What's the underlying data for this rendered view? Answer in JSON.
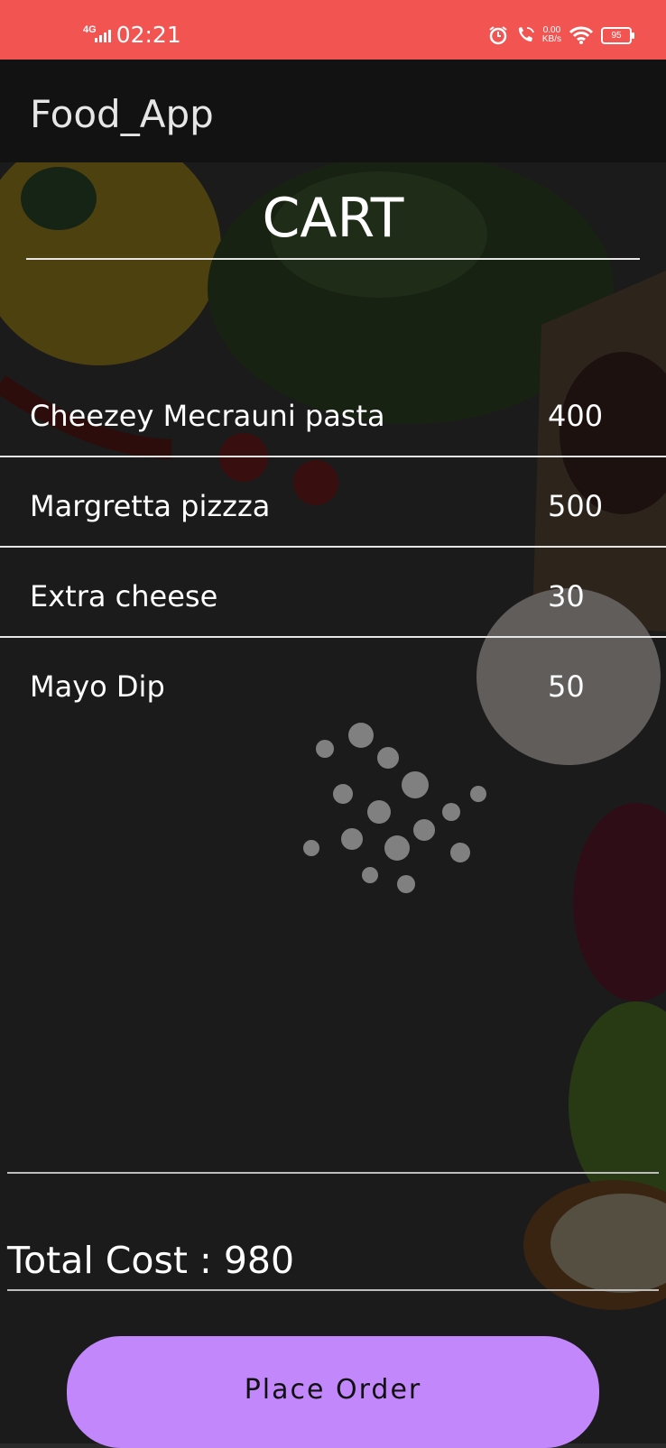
{
  "status_bar": {
    "network": "4G",
    "time": "02:21",
    "speed": "0.00",
    "speed_unit": "KB/s",
    "battery": "95",
    "icons": [
      "signal-icon",
      "alarm-icon",
      "wifi-call-icon",
      "wifi-icon",
      "battery-icon"
    ]
  },
  "app": {
    "title": "Food_App"
  },
  "cart": {
    "title": "CART",
    "items": [
      {
        "name": "Cheezey Mecrauni pasta",
        "price": "400"
      },
      {
        "name": "Margretta pizzza",
        "price": "500"
      },
      {
        "name": "Extra cheese",
        "price": "30"
      },
      {
        "name": "Mayo Dip",
        "price": "50"
      }
    ],
    "total_label": "Total Cost : 980",
    "button_label": "Place Order"
  },
  "colors": {
    "status_bar": "#f25452",
    "app_bar": "#121212",
    "button": "#c187fb",
    "background": "#2b2b2b"
  }
}
